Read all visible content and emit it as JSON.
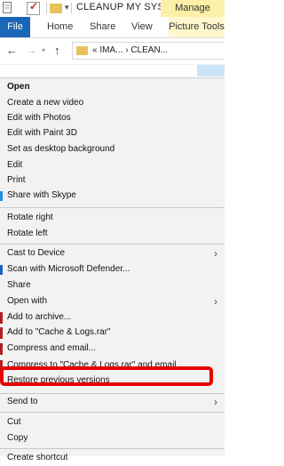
{
  "titlebar": {
    "title": "CLEANUP MY SYSTEM",
    "manage_label": "Manage"
  },
  "ribbon": {
    "tabs": [
      "File",
      "Home",
      "Share",
      "View",
      "Picture Tools"
    ]
  },
  "addressbar": {
    "path": "«  IMA...  ›  CLEAN..."
  },
  "context_menu": {
    "items": [
      {
        "label": "Open"
      },
      {
        "label": "Create a new video"
      },
      {
        "label": "Edit with Photos"
      },
      {
        "label": "Edit with Paint 3D"
      },
      {
        "label": "Set as desktop background"
      },
      {
        "label": "Edit"
      },
      {
        "label": "Print"
      },
      {
        "label": "Share with Skype"
      },
      {
        "label": "Rotate right"
      },
      {
        "label": "Rotate left"
      },
      {
        "label": "Cast to Device"
      },
      {
        "label": "Scan with Microsoft Defender..."
      },
      {
        "label": "Share"
      },
      {
        "label": "Open with"
      },
      {
        "label": "Add to archive..."
      },
      {
        "label": "Add to \"Cache & Logs.rar\""
      },
      {
        "label": "Compress and email..."
      },
      {
        "label": "Compress to \"Cache & Logs.rar\" and email"
      },
      {
        "label": "Restore previous versions"
      },
      {
        "label": "Send to"
      },
      {
        "label": "Cut"
      },
      {
        "label": "Copy"
      },
      {
        "label": "Create shortcut"
      }
    ]
  },
  "colors": {
    "file_tab": "#1a67b7",
    "manage_tab": "#fcefa8",
    "highlight_box": "#e60000",
    "archive_icon": "#b11f1f"
  }
}
